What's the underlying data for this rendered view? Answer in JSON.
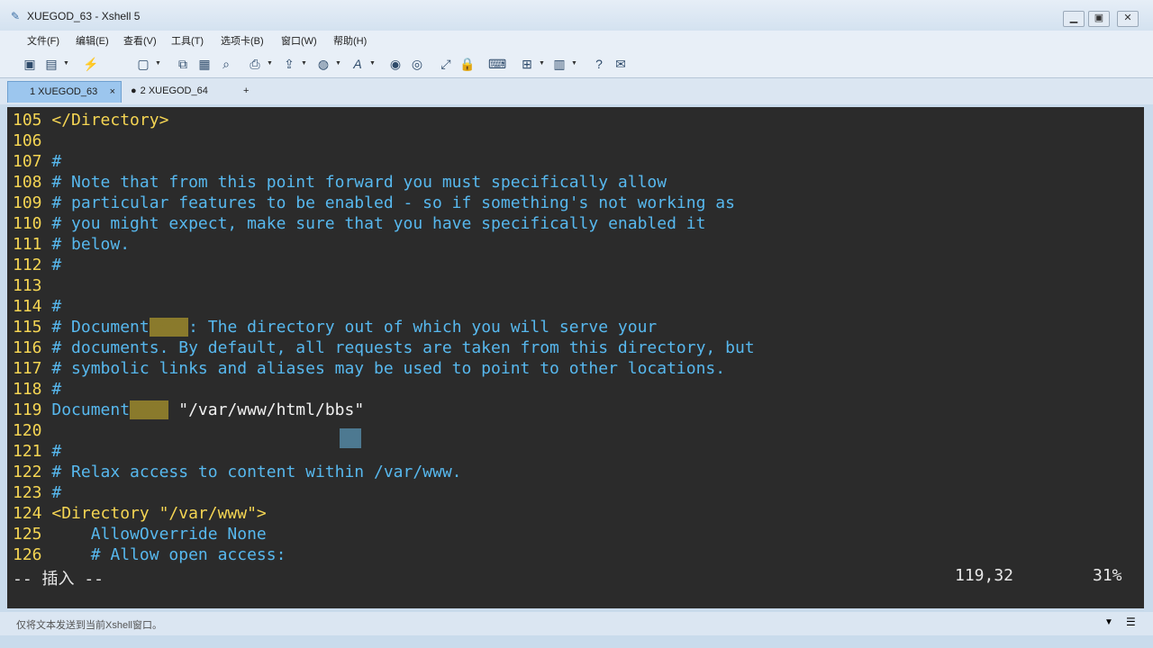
{
  "window": {
    "title": "XUEGOD_63 - Xshell 5",
    "minimize_icon": "minimize-icon",
    "maximize_icon": "maximize-icon",
    "close_icon": "close-icon"
  },
  "menu": {
    "items": [
      "文件(F)",
      "编辑(E)",
      "查看(V)",
      "工具(T)",
      "选项卡(B)",
      "窗口(W)",
      "帮助(H)"
    ]
  },
  "toolbar": {
    "icons": [
      "new-session-icon",
      "open-folder-icon",
      "reconnect-icon",
      "new-tab-icon",
      "copy-icon",
      "paste-icon",
      "find-icon",
      "print-icon",
      "transfer-icon",
      "globe-icon",
      "font-icon",
      "xftp-icon",
      "tunnel-icon",
      "fullscreen-icon",
      "lock-icon",
      "keyboard-icon",
      "add-icon",
      "layout-icon",
      "help-icon",
      "chat-icon"
    ]
  },
  "tabs": [
    {
      "label": "1 XUEGOD_63",
      "active": true
    },
    {
      "label": "2 XUEGOD_64",
      "active": false
    }
  ],
  "tab_add_label": "+",
  "terminal": {
    "lines": [
      {
        "num": "105",
        "text": "</Directory>"
      },
      {
        "num": "106",
        "text": ""
      },
      {
        "num": "107",
        "text": "#"
      },
      {
        "num": "108",
        "text": "# Note that from this point forward you must specifically allow"
      },
      {
        "num": "109",
        "text": "# particular features to be enabled - so if something's not working as"
      },
      {
        "num": "110",
        "text": "# you might expect, make sure that you have specifically enabled it"
      },
      {
        "num": "111",
        "text": "# below."
      },
      {
        "num": "112",
        "text": "#"
      },
      {
        "num": "113",
        "text": ""
      },
      {
        "num": "114",
        "text": "#"
      },
      {
        "num": "115",
        "pre": "# Document",
        "hl": "Root",
        "post": ": The directory out of which you will serve your"
      },
      {
        "num": "116",
        "text": "# documents. By default, all requests are taken from this directory, but"
      },
      {
        "num": "117",
        "text": "# symbolic links and aliases may be used to point to other locations."
      },
      {
        "num": "118",
        "text": "#"
      },
      {
        "num": "119",
        "pre": "Document",
        "hl": "Root",
        "post": " \"/var/www/html/bbs\""
      },
      {
        "num": "120",
        "text": ""
      },
      {
        "num": "121",
        "text": "#"
      },
      {
        "num": "122",
        "text": "# Relax access to content within /var/www."
      },
      {
        "num": "123",
        "text": "#"
      },
      {
        "num": "124",
        "text": "<Directory \"/var/www\">"
      },
      {
        "num": "125",
        "text": "    AllowOverride None"
      },
      {
        "num": "126",
        "text": "    # Allow open access:"
      }
    ],
    "status_mode": "-- 插入 --",
    "status_position": "119,32",
    "status_percent": "31%"
  },
  "bottom": {
    "hint": "仅将文本发送到当前Xshell窗口。"
  }
}
